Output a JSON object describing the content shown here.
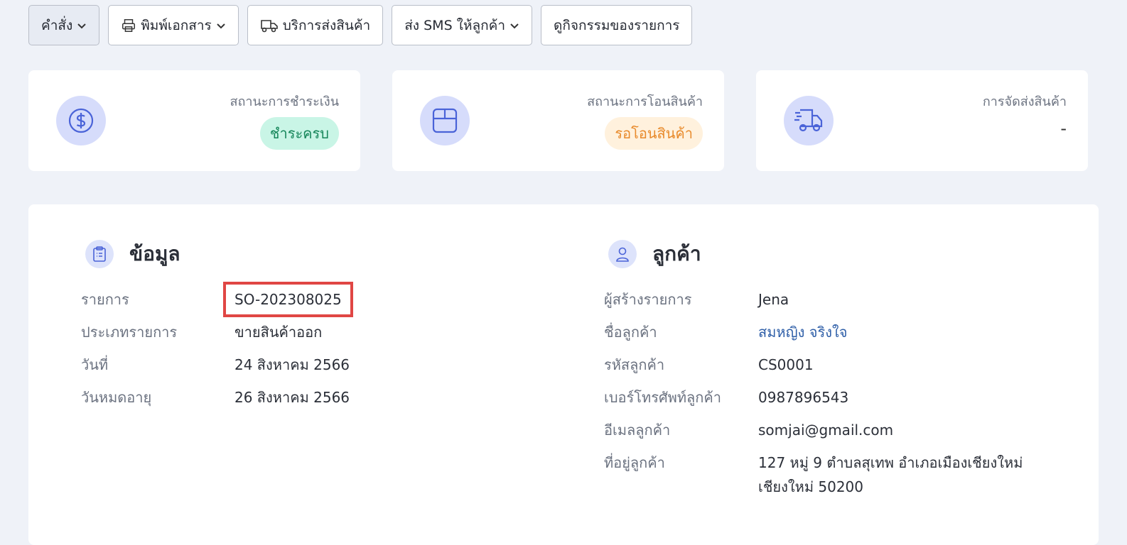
{
  "toolbar": {
    "command": "คำสั่ง",
    "print": "พิมพ์เอกสาร",
    "shipping_service": "บริการส่งสินค้า",
    "send_sms": "ส่ง SMS ให้ลูกค้า",
    "view_activity": "ดูกิจกรรมของรายการ"
  },
  "status": {
    "payment": {
      "label": "สถานะการชำระเงิน",
      "value": "ชำระครบ"
    },
    "transfer": {
      "label": "สถานะการโอนสินค้า",
      "value": "รอโอนสินค้า"
    },
    "delivery": {
      "label": "การจัดส่งสินค้า",
      "value": "-"
    }
  },
  "info": {
    "title": "ข้อมูล",
    "rows": [
      {
        "label": "รายการ",
        "value": "SO-202308025"
      },
      {
        "label": "ประเภทรายการ",
        "value": "ขายสินค้าออก"
      },
      {
        "label": "วันที่",
        "value": "24 สิงหาคม 2566"
      },
      {
        "label": "วันหมดอายุ",
        "value": "26 สิงหาคม 2566"
      }
    ]
  },
  "customer": {
    "title": "ลูกค้า",
    "rows": [
      {
        "label": "ผู้สร้างรายการ",
        "value": "Jena"
      },
      {
        "label": "ชื่อลูกค้า",
        "value": "สมหญิง จริงใจ"
      },
      {
        "label": "รหัสลูกค้า",
        "value": "CS0001"
      },
      {
        "label": "เบอร์โทรศัพท์ลูกค้า",
        "value": "0987896543"
      },
      {
        "label": "อีเมลลูกค้า",
        "value": "somjai@gmail.com"
      },
      {
        "label": "ที่อยู่ลูกค้า",
        "value_line1": "127 หมู่ 9 ตำบลสุเทพ อำเภอเมืองเชียงใหม่",
        "value_line2": "เชียงใหม่ 50200"
      }
    ]
  },
  "colors": {
    "accent": "#4a63d8",
    "paid_badge_bg": "#c9f5e6",
    "paid_badge_text": "#16865a",
    "pending_badge_bg": "#fff1dd",
    "pending_badge_text": "#e88a2b",
    "highlight_border": "#e04644",
    "link": "#2f5fa8"
  },
  "icons": {
    "payment": "dollar-circle-icon",
    "transfer": "box-icon",
    "delivery": "truck-icon",
    "info": "clipboard-icon",
    "customer": "user-icon"
  }
}
